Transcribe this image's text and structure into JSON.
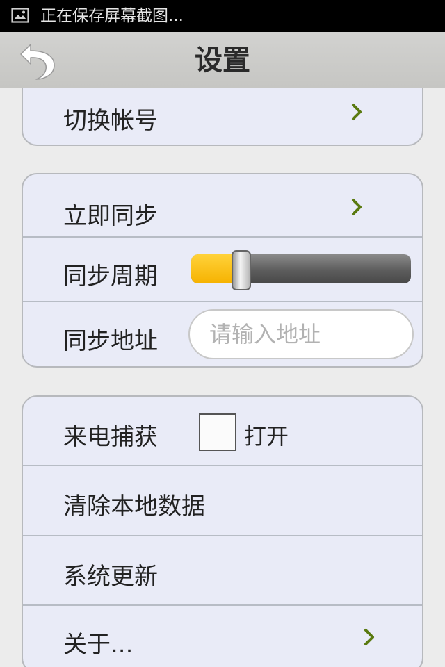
{
  "status_bar": {
    "text": "正在保存屏幕截图..."
  },
  "title_bar": {
    "title": "设置"
  },
  "groups": {
    "account": {
      "switch_account": "切换帐号"
    },
    "sync": {
      "sync_now": "立即同步",
      "sync_period": "同步周期",
      "sync_period_level": 0.21,
      "sync_address": "同步地址",
      "sync_address_placeholder": "请输入地址"
    },
    "misc": {
      "call_capture": "来电捕获",
      "call_capture_checkbox_label": "打开",
      "call_capture_checked": false,
      "clear_local_data": "清除本地数据",
      "system_update": "系统更新",
      "about": "关于..."
    }
  },
  "colors": {
    "status_bar_bg": "#000000",
    "title_bar_bg": "#c9c9c6",
    "group_bg": "#e9ebf7",
    "chevron": "#5a7a10",
    "slider_fill": "#f6b200"
  },
  "icons": [
    "image-icon",
    "back-arrow-icon",
    "chevron-right-icon"
  ]
}
